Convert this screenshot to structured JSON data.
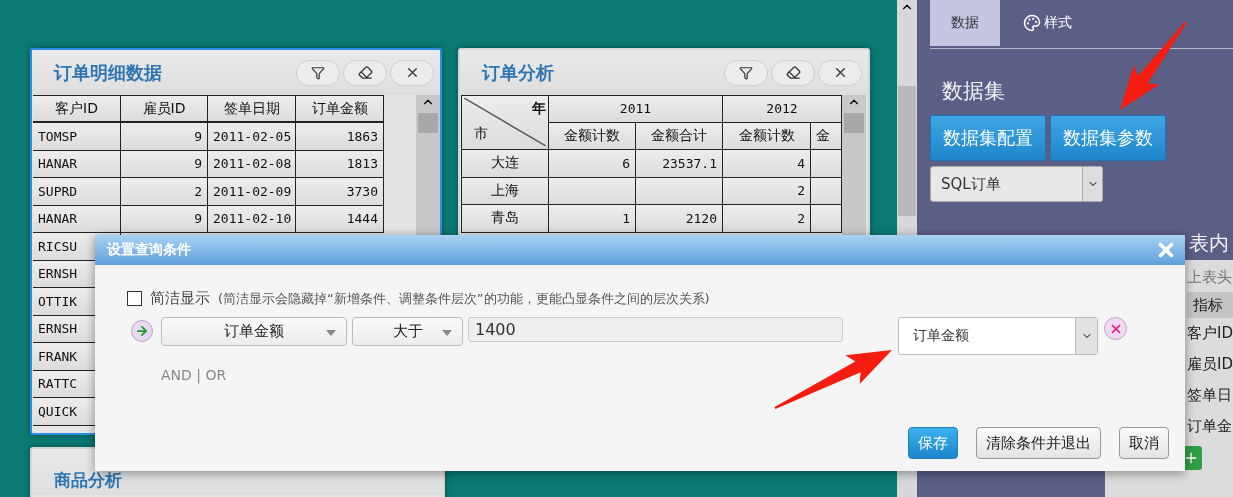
{
  "detail_panel": {
    "title": "订单明细数据",
    "selected": true,
    "columns": [
      "客户ID",
      "雇员ID",
      "签单日期",
      "订单金额"
    ],
    "rows": [
      {
        "cells": [
          "TOMSP",
          "9",
          "2011-02-05",
          "1863"
        ]
      },
      {
        "cells": [
          "HANAR",
          "9",
          "2011-02-08",
          "1813"
        ]
      },
      {
        "cells": [
          "SUPRD",
          "2",
          "2011-02-09",
          "3730"
        ]
      },
      {
        "cells": [
          "HANAR",
          "9",
          "2011-02-10",
          "1444"
        ]
      },
      {
        "cells": [
          "RICSU"
        ]
      },
      {
        "cells": [
          "ERNSH"
        ]
      },
      {
        "cells": [
          "OTTIK"
        ]
      },
      {
        "cells": [
          "ERNSH"
        ]
      },
      {
        "cells": [
          "FRANK"
        ]
      },
      {
        "cells": [
          "RATTC"
        ]
      },
      {
        "cells": [
          "QUICK"
        ]
      }
    ]
  },
  "analysis_panel": {
    "title": "订单分析",
    "corner_top": "年",
    "corner_bottom": "市",
    "years": [
      "2011",
      "2012"
    ],
    "subcolumns": [
      "金额计数",
      "金额合计",
      "金额计数",
      "金"
    ],
    "rows": [
      {
        "city": "大连",
        "count_2011": "6",
        "sum_2011": "23537.1",
        "count_2012": "4"
      },
      {
        "city": "上海",
        "count_2012": "2"
      },
      {
        "city": "青岛",
        "count_2011": "1",
        "sum_2011": "2120",
        "count_2012": "2"
      }
    ]
  },
  "bottom_panel": {
    "title": "商品分析"
  },
  "sidebar": {
    "tabs": [
      {
        "label": "数据",
        "selected": true
      },
      {
        "label": "样式",
        "selected": false
      }
    ],
    "section_title": "数据集",
    "buttons": [
      "数据集配置",
      "数据集参数"
    ],
    "dataset_select": "SQL订单",
    "content_title": "表内",
    "header_label": "上表头",
    "column_header": "指标",
    "fields": [
      "客户ID",
      "雇员ID",
      "签单日",
      "订单金"
    ]
  },
  "dialog": {
    "title": "设置查询条件",
    "simple_display": {
      "label": "简洁显示",
      "hint": "(简洁显示会隐藏掉“新增条件、调整条件层次”的功能，更能凸显条件之间的层次关系)",
      "checked": false
    },
    "condition": {
      "field": "订单金额",
      "operator": "大于",
      "value": "1400",
      "target": "订单金额"
    },
    "logic": "AND | OR",
    "buttons": [
      {
        "label": "保存",
        "kind": "primary"
      },
      {
        "label": "清除条件并退出",
        "kind": "default"
      },
      {
        "label": "取消",
        "kind": "default"
      }
    ]
  }
}
